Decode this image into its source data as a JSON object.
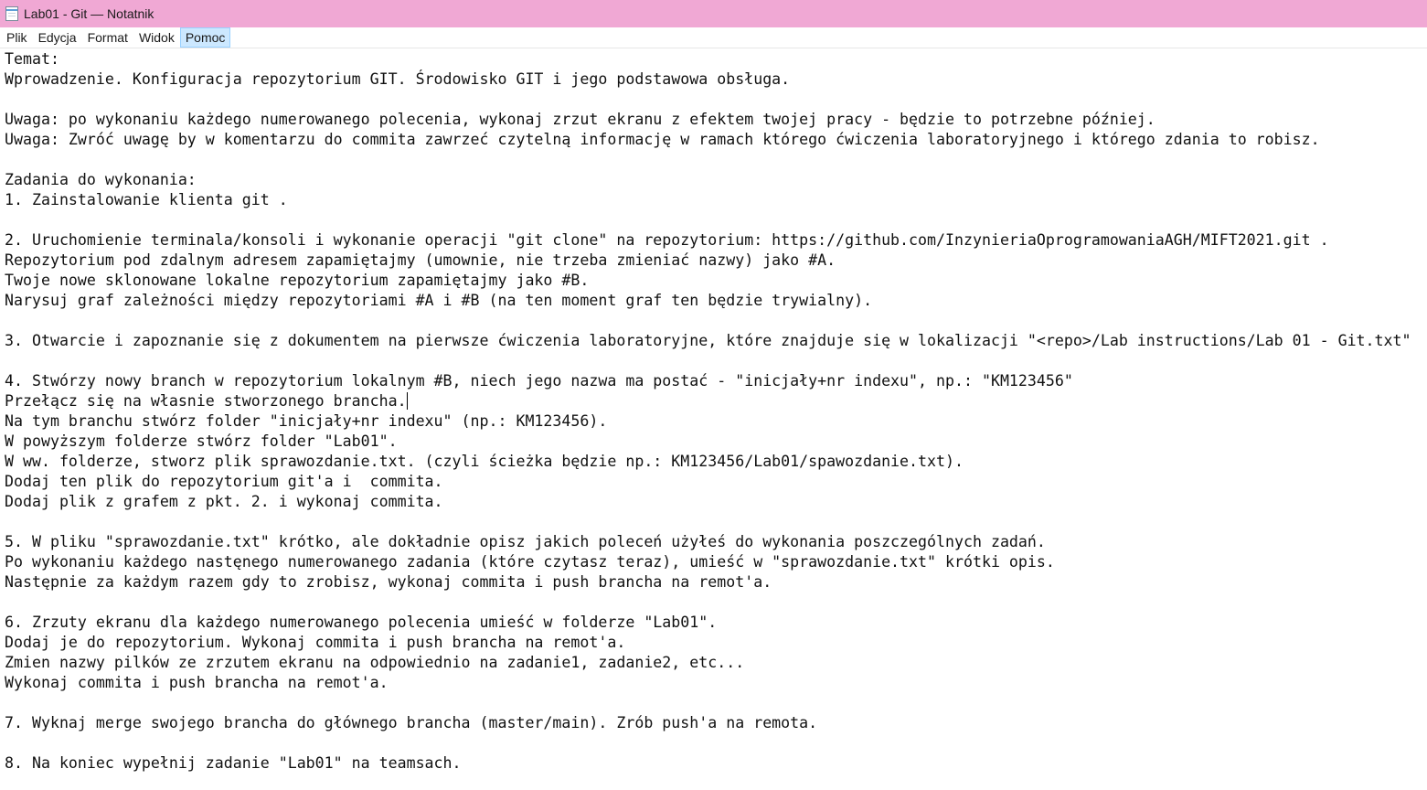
{
  "window": {
    "title": "Lab01 - Git — Notatnik",
    "icon": "notepad-icon"
  },
  "menu": {
    "items": [
      "Plik",
      "Edycja",
      "Format",
      "Widok",
      "Pomoc"
    ],
    "highlighted": "Pomoc"
  },
  "document": {
    "lines": [
      "Temat:",
      "Wprowadzenie. Konfiguracja repozytorium GIT. Środowisko GIT i jego podstawowa obsługa.",
      "",
      "Uwaga: po wykonaniu każdego numerowanego polecenia, wykonaj zrzut ekranu z efektem twojej pracy - będzie to potrzebne później.",
      "Uwaga: Zwróć uwagę by w komentarzu do commita zawrzeć czytelną informację w ramach którego ćwiczenia laboratoryjnego i którego zdania to robisz.",
      "",
      "Zadania do wykonania:",
      "1. Zainstalowanie klienta git .",
      "",
      "2. Uruchomienie terminala/konsoli i wykonanie operacji \"git clone\" na repozytorium: https://github.com/InzynieriaOprogramowaniaAGH/MIFT2021.git .",
      "Repozytorium pod zdalnym adresem zapamiętajmy (umownie, nie trzeba zmieniać nazwy) jako #A.",
      "Twoje nowe sklonowane lokalne repozytorium zapamiętajmy jako #B.",
      "Narysuj graf zależności między repozytoriami #A i #B (na ten moment graf ten będzie trywialny).",
      "",
      "3. Otwarcie i zapoznanie się z dokumentem na pierwsze ćwiczenia laboratoryjne, które znajduje się w lokalizacji \"<repo>/Lab instructions/Lab 01 - Git.txt\"",
      "",
      "4. Stwórzy nowy branch w repozytorium lokalnym #B, niech jego nazwa ma postać - \"inicjały+nr indexu\", np.: \"KM123456\"",
      "Przełącz się na własnie stworzonego brancha.",
      "Na tym branchu stwórz folder \"inicjały+nr indexu\" (np.: KM123456).",
      "W powyższym folderze stwórz folder \"Lab01\".",
      "W ww. folderze, stworz plik sprawozdanie.txt. (czyli ścieżka będzie np.: KM123456/Lab01/spawozdanie.txt).",
      "Dodaj ten plik do repozytorium git'a i  commita.",
      "Dodaj plik z grafem z pkt. 2. i wykonaj commita.",
      "",
      "5. W pliku \"sprawozdanie.txt\" krótko, ale dokładnie opisz jakich poleceń użyłeś do wykonania poszczególnych zadań.",
      "Po wykonaniu każdego nastęnego numerowanego zadania (które czytasz teraz), umieść w \"sprawozdanie.txt\" krótki opis.",
      "Następnie za każdym razem gdy to zrobisz, wykonaj commita i push brancha na remot'a.",
      "",
      "6. Zrzuty ekranu dla każdego numerowanego polecenia umieść w folderze \"Lab01\".",
      "Dodaj je do repozytorium. Wykonaj commita i push brancha na remot'a.",
      "Zmien nazwy pilków ze zrzutem ekranu na odpowiednio na zadanie1, zadanie2, etc...",
      "Wykonaj commita i push brancha na remot'a.",
      "",
      "7. Wyknaj merge swojego brancha do głównego brancha (master/main). Zrób push'a na remota.",
      "",
      "8. Na koniec wypełnij zadanie \"Lab01\" na teamsach."
    ],
    "caret_line": 17
  }
}
